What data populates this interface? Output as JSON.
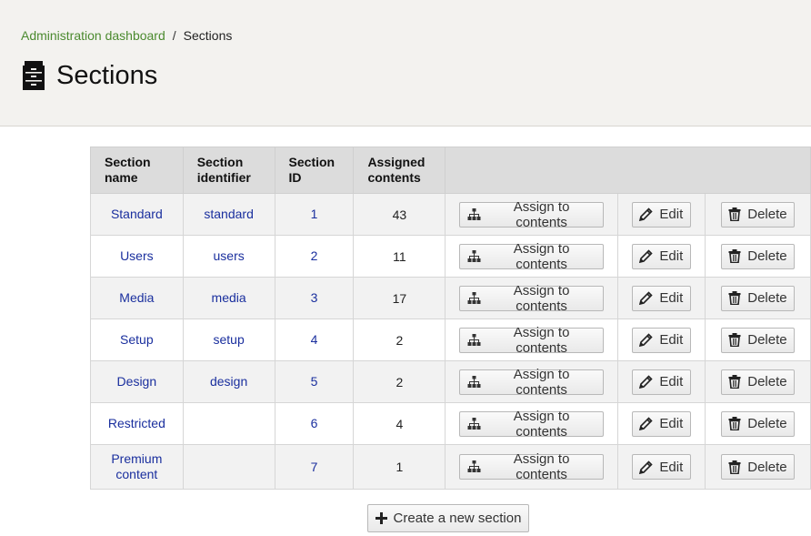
{
  "breadcrumb": {
    "home_label": "Administration dashboard",
    "separator": "/",
    "current": "Sections"
  },
  "page": {
    "title": "Sections",
    "title_icon": "sections-cabinet-icon"
  },
  "table": {
    "headers": {
      "name": "Section name",
      "identifier": "Section identifier",
      "id": "Section ID",
      "assigned": "Assigned contents"
    },
    "rows": [
      {
        "name": "Standard",
        "identifier": "standard",
        "id": "1",
        "assigned": "43"
      },
      {
        "name": "Users",
        "identifier": "users",
        "id": "2",
        "assigned": "11"
      },
      {
        "name": "Media",
        "identifier": "media",
        "id": "3",
        "assigned": "17"
      },
      {
        "name": "Setup",
        "identifier": "setup",
        "id": "4",
        "assigned": "2"
      },
      {
        "name": "Design",
        "identifier": "design",
        "id": "5",
        "assigned": "2"
      },
      {
        "name": "Restricted",
        "identifier": "",
        "id": "6",
        "assigned": "4"
      },
      {
        "name": "Premium content",
        "identifier": "",
        "id": "7",
        "assigned": "1"
      }
    ]
  },
  "actions": {
    "assign_label": "Assign to contents",
    "edit_label": "Edit",
    "delete_label": "Delete",
    "create_label": "Create a new section"
  },
  "colors": {
    "link": "#1a2f9e",
    "breadcrumb_link": "#4b8a2f",
    "header_bg": "#f3f2ef",
    "table_header_bg": "#dcdcdc"
  }
}
